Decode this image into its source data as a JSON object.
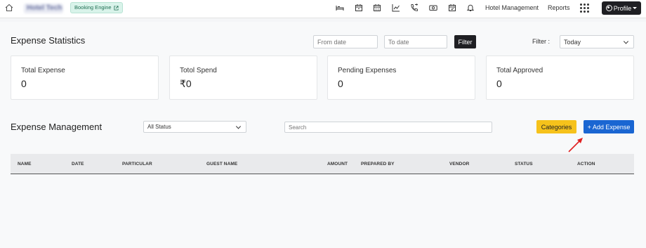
{
  "navbar": {
    "brand": "Hotel Tech",
    "booking_engine_label": "Booking Engine",
    "icons": [
      "bed-icon",
      "calendar-icon",
      "calendar-grid-icon",
      "chart-line-icon",
      "phone-icon",
      "cash-icon",
      "calendar-check-icon",
      "bell-icon"
    ],
    "links": [
      "Hotel Management",
      "Reports"
    ],
    "profile_label": "Profile"
  },
  "stats": {
    "title": "Expense Statistics",
    "from_placeholder": "From date",
    "to_placeholder": "To date",
    "filter_button": "Filter",
    "filter_label": "Filter :",
    "filter_value": "Today",
    "cards": [
      {
        "label": "Total Expense",
        "value": "0"
      },
      {
        "label": "Totol Spend",
        "value": "₹0"
      },
      {
        "label": "Pending Expenses",
        "value": "0"
      },
      {
        "label": "Total Approved",
        "value": "0"
      }
    ]
  },
  "management": {
    "title": "Expense Management",
    "status_value": "All Status",
    "search_placeholder": "Search",
    "categories_button": "Categories",
    "add_button": "+ Add Expense",
    "columns": [
      "NAME",
      "DATE",
      "PARTICULAR",
      "GUEST NAME",
      "AMOUNT",
      "PREPARED BY",
      "VENDOR",
      "STATUS",
      "ACTION"
    ]
  },
  "colors": {
    "primary": "#1a66d2",
    "warning": "#f6c21b",
    "dark": "#1f1f23",
    "annotation_arrow": "#e02020"
  }
}
